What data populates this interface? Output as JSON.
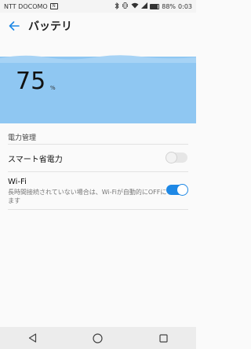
{
  "status_bar": {
    "carrier": "NTT DOCOMO",
    "nfc": "N",
    "battery": "88%",
    "time": "0:03"
  },
  "header": {
    "title": "バッテリ",
    "back_icon": "back-arrow-icon",
    "accent": "#1e88e5"
  },
  "battery_level": {
    "value": "75",
    "unit": "%",
    "panel_color": "#8fc7f2"
  },
  "power_management": {
    "section_title": "電力管理",
    "items": [
      {
        "title": "スマート省電力",
        "toggle_on": false
      },
      {
        "title": "Wi-Fi",
        "description": "長時間接続されていない場合は、Wi-Fiが自動的にOFFになります",
        "toggle_on": true
      }
    ]
  },
  "nav_bar": {
    "back_icon": "triangle-back-icon",
    "home_icon": "circle-home-icon",
    "recents_icon": "square-recents-icon"
  }
}
